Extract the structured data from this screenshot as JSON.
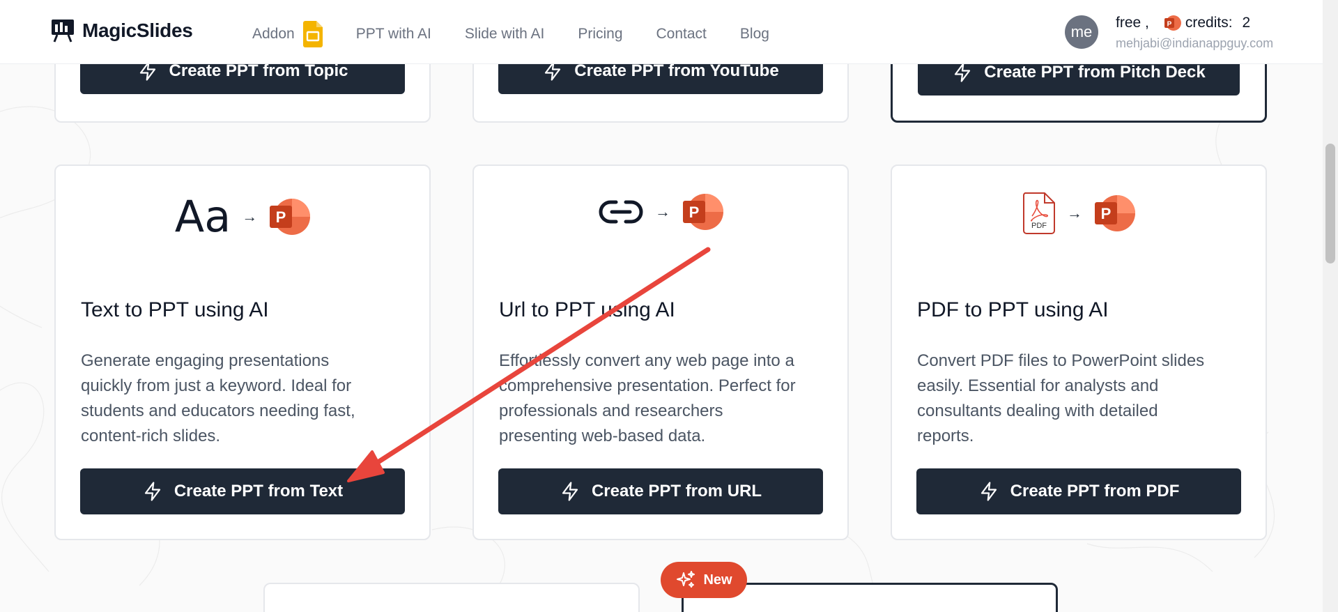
{
  "brand": {
    "name": "MagicSlides"
  },
  "nav": {
    "links": [
      {
        "label": "Addon"
      },
      {
        "label": "PPT with AI"
      },
      {
        "label": "Slide with AI"
      },
      {
        "label": "Pricing"
      },
      {
        "label": "Contact"
      },
      {
        "label": "Blog"
      }
    ]
  },
  "user": {
    "avatar": "me",
    "plan": "free ,",
    "credits_label": "credits:",
    "credits_value": "2",
    "email": "mehjabi@indianappguy.com"
  },
  "top_buttons": [
    {
      "label": "Create PPT from Topic"
    },
    {
      "label": "Create PPT from YouTube"
    },
    {
      "label": "Create PPT from Pitch Deck"
    }
  ],
  "cards": [
    {
      "title": "Text to PPT using AI",
      "description": "Generate engaging presentations quickly from just a keyword. Ideal for students and educators needing fast, content-rich slides.",
      "button": "Create PPT from Text",
      "source_icon": "text-aa-icon",
      "source_text": "Aa"
    },
    {
      "title": "Url to PPT using AI",
      "description": "Effortlessly convert any web page into a comprehensive presentation. Perfect for professionals and researchers presenting web-based data.",
      "button": "Create PPT from URL",
      "source_icon": "link-icon"
    },
    {
      "title": "PDF to PPT using AI",
      "description": "Convert PDF files to PowerPoint slides easily. Essential for analysts and consultants dealing with detailed reports.",
      "button": "Create PPT from PDF",
      "source_icon": "pdf-file-icon",
      "source_text": "PDF"
    }
  ],
  "arrow_glyph": "→",
  "new_badge": {
    "label": "New",
    "icon": "sparkles-icon"
  },
  "colors": {
    "button_bg": "#1f2937",
    "accent": "#e0492e",
    "annotation_arrow": "#e8453c",
    "ppt_orange": "#d24726"
  }
}
